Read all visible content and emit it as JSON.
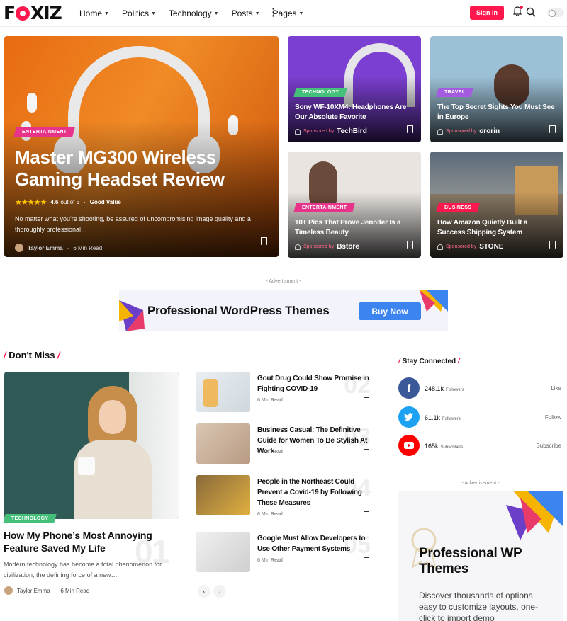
{
  "header": {
    "logo": "FOXIZ",
    "nav": [
      {
        "label": "Home"
      },
      {
        "label": "Politics"
      },
      {
        "label": "Technology"
      },
      {
        "label": "Posts"
      },
      {
        "label": "Pages"
      }
    ],
    "signin_label": "Sign In"
  },
  "hero": {
    "category": "ENTERTAINMENT",
    "title": "Master MG300 Wireless Gaming Headset Review",
    "rating": "4.6",
    "rating_suffix": "out of 5",
    "rating_value_label": "Good Value",
    "excerpt": "No matter what you're shooting, be assured of uncompromising image quality and a thoroughly professional…",
    "author": "Taylor Emma",
    "read_time": "6 Min Read"
  },
  "grid": [
    {
      "category": "TECHNOLOGY",
      "title": "Sony WF-10XM4: Headphones Are Our Absolute Favorite",
      "sponsored": "Sponsored by",
      "brand": "TechBird"
    },
    {
      "category": "TRAVEL",
      "title": "The Top Secret Sights You Must See in Europe",
      "sponsored": "Sponsored by",
      "brand": "ororin"
    },
    {
      "category": "ENTERTAINMENT",
      "title": "10+ Pics That Prove Jennifer Is a Timeless Beauty",
      "sponsored": "Sponsored by",
      "brand": "Bstore"
    },
    {
      "category": "BUSINESS",
      "title": "How Amazon Quietly Built a Success Shipping System",
      "sponsored": "Sponsored by",
      "brand": "STONE"
    }
  ],
  "advert": {
    "label": "- Advertisment -",
    "banner_title": "Professional WordPress Themes",
    "banner_button": "Buy Now"
  },
  "dont_miss": {
    "heading": "Don't Miss",
    "featured": {
      "category": "TECHNOLOGY",
      "title": "How My Phone’s Most Annoying Feature Saved My Life",
      "excerpt": "Modern technology has become a total phenomenon for civilization, the defining force of a new…",
      "number": "01",
      "author": "Taylor Emma",
      "read_time": "6 Min Read"
    },
    "list": [
      {
        "title": "Gout Drug Could Show Promise in Fighting COVID-19",
        "read_time": "6 Min Read",
        "number": "02"
      },
      {
        "title": "Business Casual: The Definitive Guide for Women To Be Stylish At Work",
        "read_time": "6 Min Read",
        "number": "03"
      },
      {
        "title": "People in the Northeast Could Prevent a Covid-19 by Following These Measures",
        "read_time": "6 Min Read",
        "number": "04"
      },
      {
        "title": "Google Must Allow Developers to Use Other Payment Systems",
        "read_time": "6 Min Read",
        "number": "05"
      }
    ],
    "prev": "‹",
    "next": "›"
  },
  "stay_connected": {
    "heading": "Stay Connected",
    "items": [
      {
        "icon": "facebook-icon",
        "count": "248.1k",
        "unit": "Followers",
        "action": "Like",
        "color": "#3b5998"
      },
      {
        "icon": "twitter-icon",
        "count": "61.1k",
        "unit": "Followers",
        "action": "Follow",
        "color": "#1da1f2"
      },
      {
        "icon": "youtube-icon",
        "count": "165k",
        "unit": "Subscribers",
        "action": "Subscribe",
        "color": "#ff0000"
      }
    ]
  },
  "side_ad": {
    "label": "- Advertisement -",
    "title": "Professional WP Themes",
    "desc": "Discover thousands of options, easy to customize layouts, one-click to import demo"
  }
}
